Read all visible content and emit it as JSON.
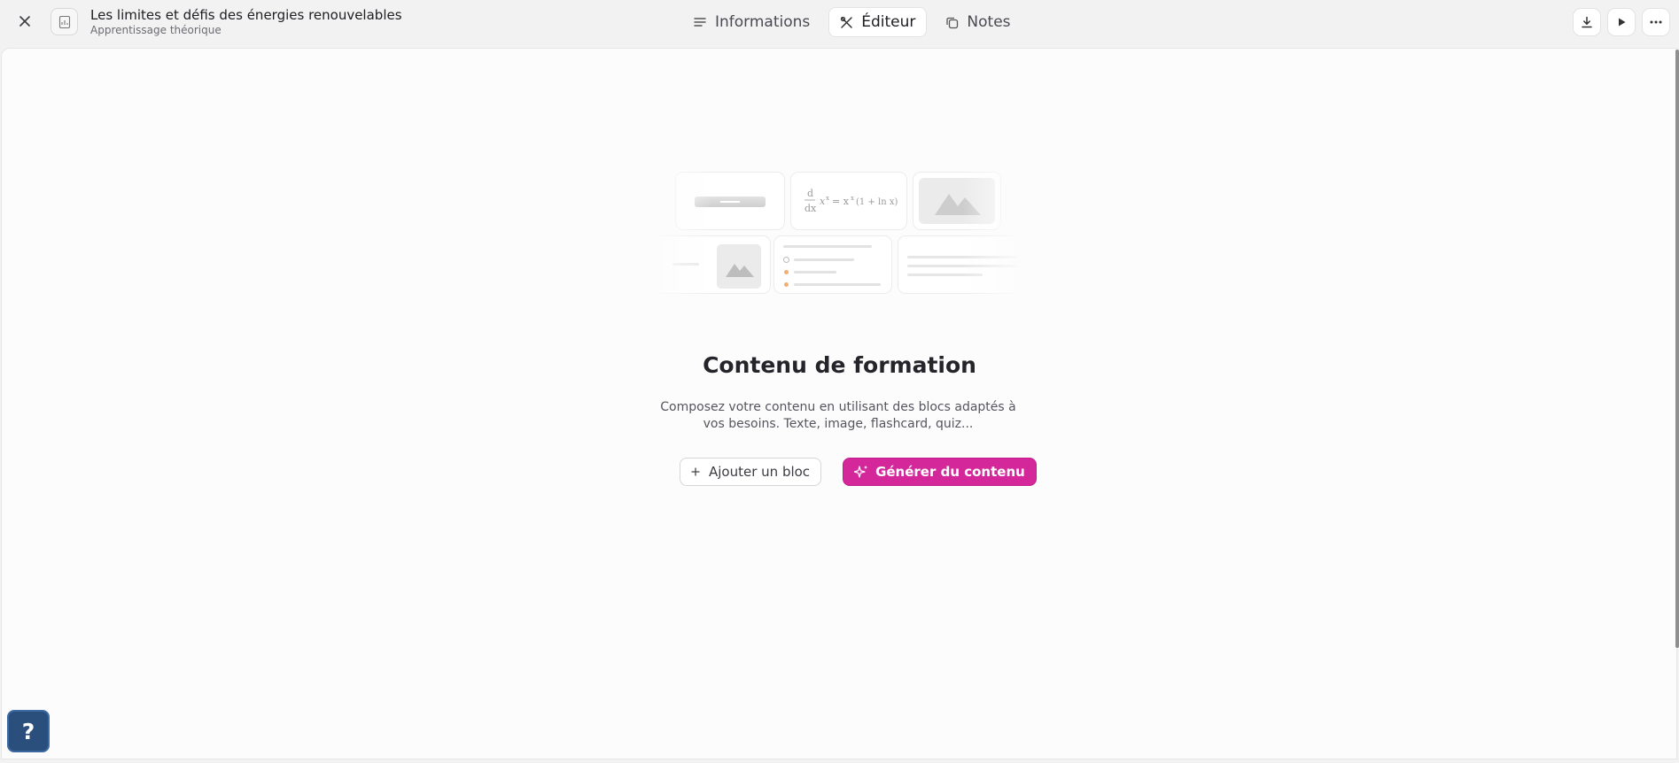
{
  "header": {
    "title": "Les limites et défis des énergies renouvelables",
    "subtitle": "Apprentissage théorique",
    "close_icon": "close-icon",
    "doc_icon": "document-icon"
  },
  "tabs": [
    {
      "label": "Informations",
      "icon": "lines-icon",
      "active": false
    },
    {
      "label": "Éditeur",
      "icon": "tools-icon",
      "active": true
    },
    {
      "label": "Notes",
      "icon": "copy-icon",
      "active": false
    }
  ],
  "actions": {
    "download_icon": "download-icon",
    "play_icon": "play-icon",
    "more_icon": "more-icon"
  },
  "empty_state": {
    "heading": "Contenu de formation",
    "description": "Composez votre contenu en utilisant des blocs adaptés à vos besoins. Texte, image, flashcard, quiz...",
    "add_block_label": "Ajouter un bloc",
    "generate_label": "Générer du contenu"
  },
  "help": {
    "label": "?"
  },
  "colors": {
    "accent": "#d4279a",
    "help_bg": "#2b4f7c"
  }
}
